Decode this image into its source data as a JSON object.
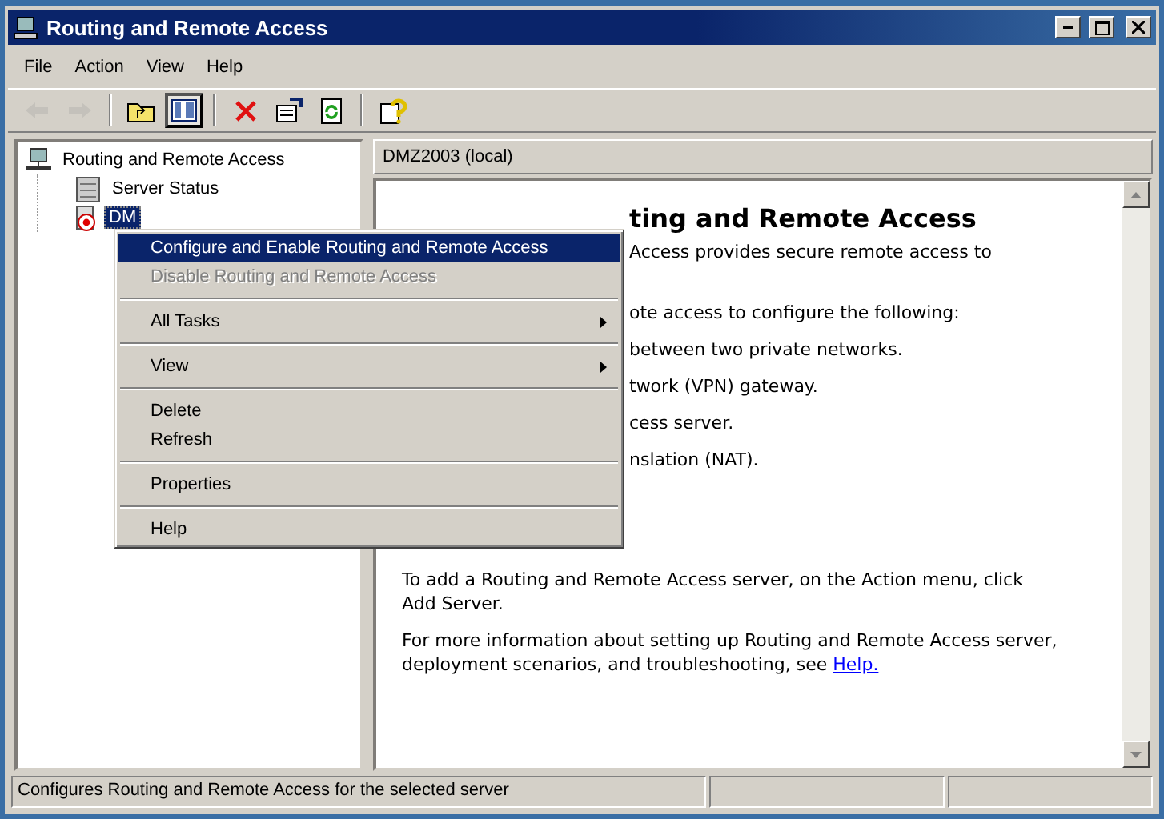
{
  "window": {
    "title": "Routing and Remote Access"
  },
  "menu_bar": [
    "File",
    "Action",
    "View",
    "Help"
  ],
  "toolbar": [
    {
      "kind": "back",
      "disabled": true,
      "pressed": false
    },
    {
      "kind": "forward",
      "disabled": true,
      "pressed": false
    },
    {
      "kind": "separator"
    },
    {
      "kind": "up",
      "disabled": false,
      "pressed": false
    },
    {
      "kind": "tree",
      "disabled": false,
      "pressed": true
    },
    {
      "kind": "separator"
    },
    {
      "kind": "delete",
      "disabled": false,
      "pressed": false
    },
    {
      "kind": "properties",
      "disabled": false,
      "pressed": false
    },
    {
      "kind": "refresh",
      "disabled": false,
      "pressed": false
    },
    {
      "kind": "separator"
    },
    {
      "kind": "help",
      "disabled": false,
      "pressed": false
    }
  ],
  "tree": [
    {
      "label": "Routing and Remote Access",
      "kind": "root",
      "selected": false,
      "children": [
        {
          "label": "Server Status",
          "kind": "status",
          "selected": false
        },
        {
          "label": "DM",
          "kind": "server",
          "selected": true
        }
      ]
    }
  ],
  "right_pane": {
    "header": "DMZ2003 (local)",
    "heading": "ting and Remote Access",
    "lines": [
      "Access provides secure remote access to",
      "ote access to configure the following:",
      "between two private networks.",
      "twork (VPN) gateway.",
      "cess server.",
      "nslation (NAT)."
    ],
    "paragraphs": [
      {
        "text": "To add a Routing and Remote Access server, on the Action menu, click Add Server."
      },
      {
        "text": "For more information about setting up Routing and Remote Access server, deployment scenarios, and troubleshooting, see",
        "link": "Help."
      }
    ]
  },
  "context_menu": [
    {
      "kind": "item",
      "label": "Configure and Enable Routing and Remote Access",
      "selected": true,
      "disabled": false,
      "submenu": false
    },
    {
      "kind": "item",
      "label": "Disable Routing and Remote Access",
      "selected": false,
      "disabled": true,
      "submenu": false
    },
    {
      "kind": "separator"
    },
    {
      "kind": "item",
      "label": "All Tasks",
      "selected": false,
      "disabled": false,
      "submenu": true
    },
    {
      "kind": "separator"
    },
    {
      "kind": "item",
      "label": "View",
      "selected": false,
      "disabled": false,
      "submenu": true
    },
    {
      "kind": "separator"
    },
    {
      "kind": "item",
      "label": "Delete",
      "selected": false,
      "disabled": false,
      "submenu": false
    },
    {
      "kind": "item",
      "label": "Refresh",
      "selected": false,
      "disabled": false,
      "submenu": false
    },
    {
      "kind": "separator"
    },
    {
      "kind": "item",
      "label": "Properties",
      "selected": false,
      "disabled": false,
      "submenu": false
    },
    {
      "kind": "separator"
    },
    {
      "kind": "item",
      "label": "Help",
      "selected": false,
      "disabled": false,
      "submenu": false
    }
  ],
  "status_bar": {
    "text": "Configures Routing and Remote Access for the selected server"
  }
}
